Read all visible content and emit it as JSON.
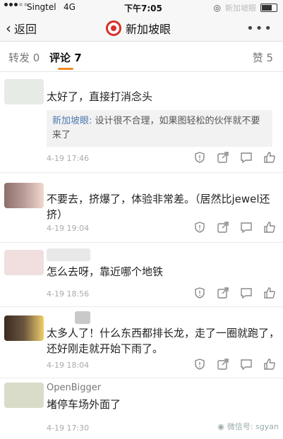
{
  "status_bar": {
    "carrier": "Singtel",
    "network": "4G",
    "time": "下午7:05",
    "right_text": "新加坡眼"
  },
  "nav": {
    "back_label": "返回",
    "title": "新加坡眼",
    "more": "•••"
  },
  "tabs": {
    "repost": "转发 0",
    "comments": "评论 7",
    "likes": "赞 5"
  },
  "comments": [
    {
      "text": "太好了，直接打消念头",
      "reply_name": "新加坡眼:",
      "reply_text": "设计很不合理，如果图轻松的伙伴就不要来了",
      "time": "4-19 17:46",
      "avatar_color": "#e6ebe6"
    },
    {
      "text": "不要去，挤爆了，体验非常差。（居然比jewel还挤）",
      "time": "4-19 19:04",
      "avatar_color": "#9a7f7a"
    },
    {
      "text": "怎么去呀，靠近哪个地铁",
      "time": "4-19 18:56",
      "avatar_color": "#f1dede"
    },
    {
      "text": "太多人了！什么东西都排长龙，走了一圈就跑了，还好刚走就开始下雨了。",
      "time": "4-19 18:04",
      "avatar_color": "#5a463a"
    },
    {
      "username": "OpenBigger",
      "text": "堵停车场外面了",
      "time": "4-19 17:30",
      "avatar_color": "#d9dcc8"
    }
  ],
  "watermark": "微信号: sgyan"
}
